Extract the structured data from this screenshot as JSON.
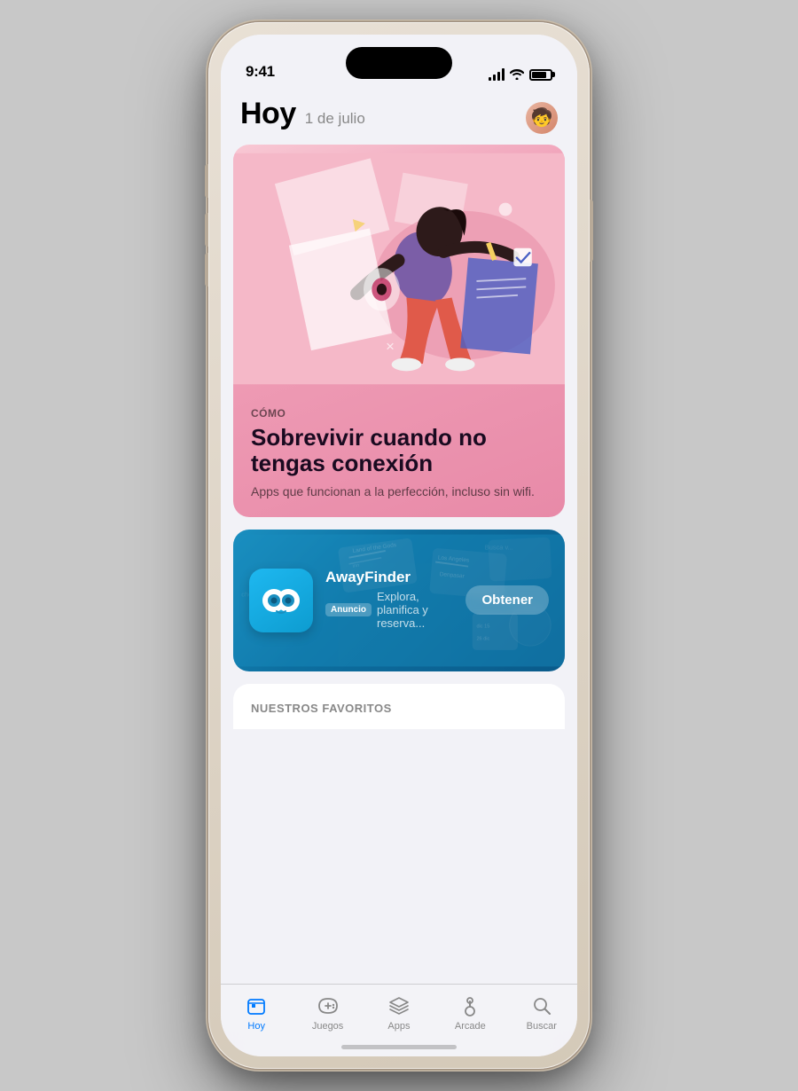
{
  "status_bar": {
    "time": "9:41"
  },
  "header": {
    "title": "Hoy",
    "date": "1 de julio"
  },
  "featured_card": {
    "label": "CÓMO",
    "title": "Sobrevivir cuando no tengas conexión",
    "subtitle": "Apps que funcionan a la perfección, incluso sin wifi."
  },
  "ad_card": {
    "app_name": "AwayFinder",
    "badge": "Anuncio",
    "description": "Explora, planifica y reserva...",
    "get_button": "Obtener"
  },
  "section": {
    "title": "NUESTROS FAVORITOS"
  },
  "tab_bar": {
    "items": [
      {
        "label": "Hoy",
        "active": true,
        "icon": "today-icon"
      },
      {
        "label": "Juegos",
        "active": false,
        "icon": "games-icon"
      },
      {
        "label": "Apps",
        "active": false,
        "icon": "apps-icon"
      },
      {
        "label": "Arcade",
        "active": false,
        "icon": "arcade-icon"
      },
      {
        "label": "Buscar",
        "active": false,
        "icon": "search-icon"
      }
    ]
  }
}
